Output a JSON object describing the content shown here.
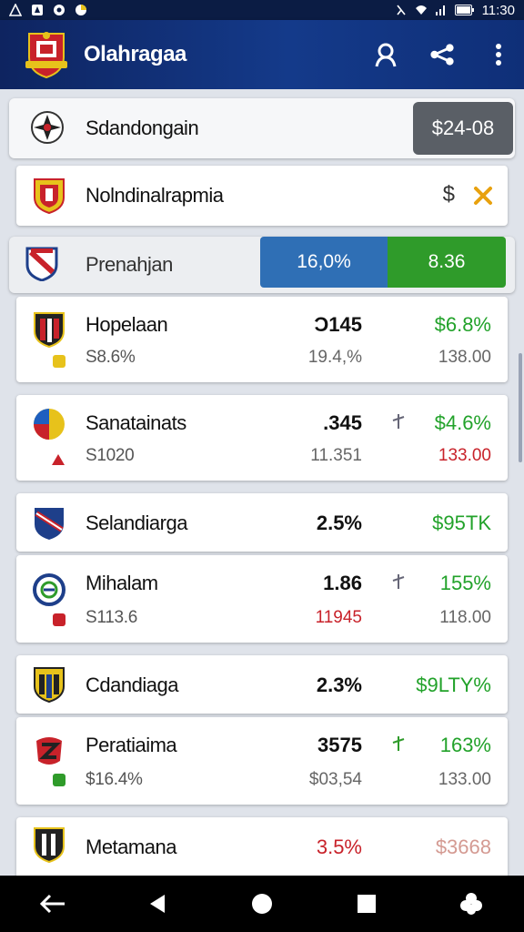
{
  "status_bar": {
    "time": "11:30"
  },
  "app_bar": {
    "title": "Olahragaa"
  },
  "header_card": {
    "name": "Sdandongain",
    "price": "$24-08"
  },
  "featured_card": {
    "name": "Nolndinalrapmia",
    "symbol": "$"
  },
  "summary_card": {
    "name": "Prenahjan",
    "pill_left": "16,0%",
    "pill_right": "8.36"
  },
  "rows": [
    {
      "name": "Hopelaan",
      "sub": "S8.6%",
      "value": "Ɔ145",
      "value_sub": "19.4,%",
      "change": "$6.8%",
      "change_sub": "138.00"
    },
    {
      "name": "Sanatainats",
      "sub": "S1020",
      "value": ".345",
      "value_sub": "11.351",
      "change": "$4.6%",
      "change_sub": "133.00"
    },
    {
      "name": "Selandiarga",
      "value": "2.5%",
      "change": "$95TK"
    },
    {
      "name": "Mihalam",
      "sub": "S113.6",
      "value": "1.86",
      "value_sub": "11945",
      "change": "155%",
      "change_sub": "118.00"
    },
    {
      "name": "Cdandiaga",
      "value": "2.3%",
      "change": "$9LTY%"
    },
    {
      "name": "Peratiaima",
      "sub": "$16.4%",
      "value": "3575",
      "value_sub": "$03,54",
      "change": "163%",
      "change_sub": "133.00"
    },
    {
      "name": "Metamana",
      "value": "3.5%",
      "change": "$3668"
    }
  ],
  "colors": {
    "primary": "#143a8a",
    "positive": "#22a22a",
    "negative": "#c8222a",
    "pill_blue": "#2f6fb5",
    "pill_green": "#2f9b2a",
    "price_chip": "#5a5f66"
  }
}
